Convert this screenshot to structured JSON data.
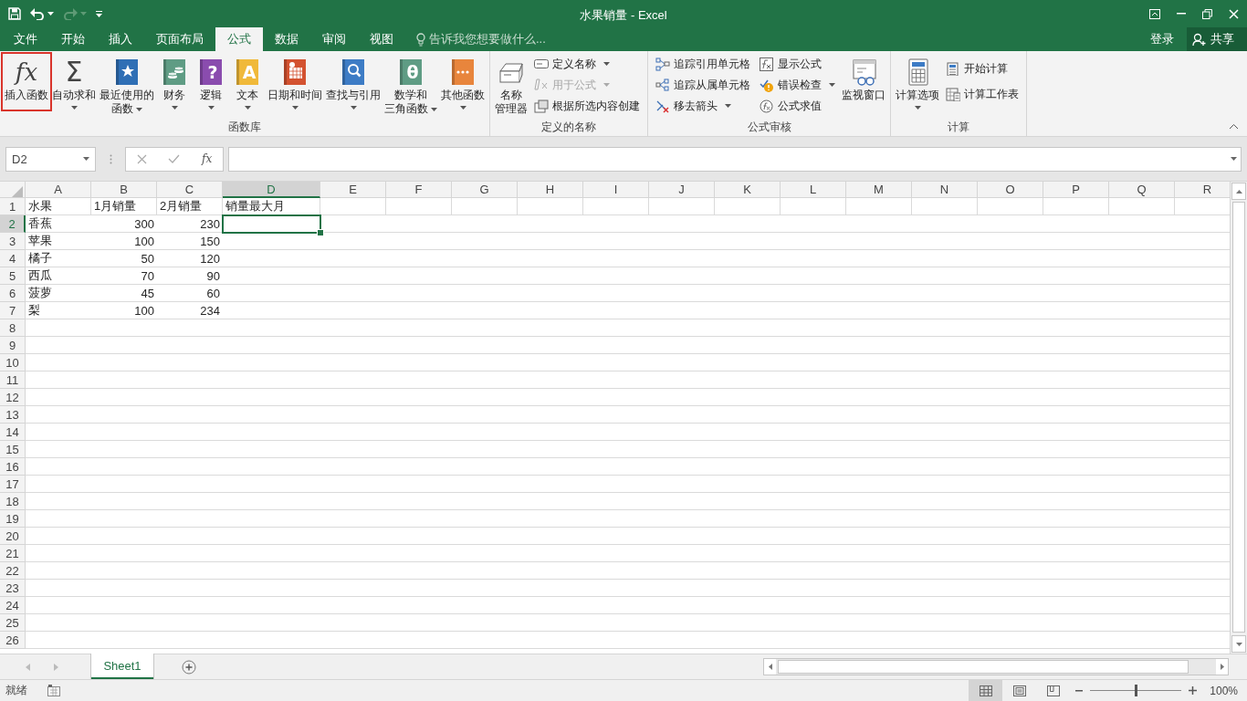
{
  "window": {
    "title": "水果销量 - Excel"
  },
  "tabs": [
    {
      "label": "文件",
      "selected": false
    },
    {
      "label": "开始",
      "selected": false
    },
    {
      "label": "插入",
      "selected": false
    },
    {
      "label": "页面布局",
      "selected": false
    },
    {
      "label": "公式",
      "selected": true
    },
    {
      "label": "数据",
      "selected": false
    },
    {
      "label": "审阅",
      "selected": false
    },
    {
      "label": "视图",
      "selected": false
    }
  ],
  "tell_me": {
    "placeholder": "告诉我您想要做什么..."
  },
  "account": {
    "sign_in": "登录",
    "share": "共享"
  },
  "ribbon": {
    "groups": [
      {
        "label": "函数库",
        "commands": [
          {
            "kind": "large",
            "lines": [
              "插入函数"
            ],
            "glyph": "fx",
            "dropdown": false,
            "disabled": false,
            "outlined": true
          },
          {
            "kind": "large",
            "lines": [
              "自动求和"
            ],
            "glyph": "Σ",
            "dropdown": true,
            "disabled": false,
            "outlined": false
          },
          {
            "kind": "large",
            "lines": [
              "最近使用的",
              "函数"
            ],
            "dropdown": true,
            "disabled": false,
            "outlined": false
          },
          {
            "kind": "large",
            "lines": [
              "财务"
            ],
            "dropdown": true,
            "disabled": false,
            "outlined": false
          },
          {
            "kind": "large",
            "lines": [
              "逻辑"
            ],
            "glyph": "?",
            "dropdown": true,
            "disabled": false,
            "outlined": false
          },
          {
            "kind": "large",
            "lines": [
              "文本"
            ],
            "glyph": "A",
            "dropdown": true,
            "disabled": false,
            "outlined": false
          },
          {
            "kind": "large",
            "lines": [
              "日期和时间"
            ],
            "dropdown": true,
            "disabled": false,
            "outlined": false
          },
          {
            "kind": "large",
            "lines": [
              "查找与引用"
            ],
            "dropdown": true,
            "disabled": false,
            "outlined": false
          },
          {
            "kind": "large",
            "lines": [
              "数学和",
              "三角函数"
            ],
            "glyph": "θ",
            "dropdown": true,
            "disabled": false,
            "outlined": false
          },
          {
            "kind": "large",
            "lines": [
              "其他函数"
            ],
            "dropdown": true,
            "disabled": false,
            "outlined": false
          }
        ]
      },
      {
        "label": "定义的名称",
        "commands": [
          {
            "kind": "large",
            "lines": [
              "名称",
              "管理器"
            ],
            "dropdown": false,
            "disabled": false,
            "outlined": false
          },
          {
            "kind": "small",
            "label": "定义名称",
            "dropdown": true,
            "disabled": false,
            "outlined": false
          },
          {
            "kind": "small",
            "label": "用于公式",
            "dropdown": true,
            "disabled": true,
            "outlined": false
          },
          {
            "kind": "small",
            "label": "根据所选内容创建",
            "dropdown": false,
            "disabled": false,
            "outlined": false
          }
        ]
      },
      {
        "label": "公式审核",
        "commands": [
          {
            "kind": "small",
            "label": "追踪引用单元格",
            "dropdown": false,
            "disabled": false,
            "outlined": false
          },
          {
            "kind": "small",
            "label": "追踪从属单元格",
            "dropdown": false,
            "disabled": false,
            "outlined": false
          },
          {
            "kind": "small",
            "label": "移去箭头",
            "dropdown": true,
            "disabled": false,
            "outlined": false
          },
          {
            "kind": "small",
            "label": "显示公式",
            "dropdown": false,
            "disabled": false,
            "outlined": false
          },
          {
            "kind": "small",
            "label": "错误检查",
            "dropdown": true,
            "disabled": false,
            "outlined": false
          },
          {
            "kind": "small",
            "label": "公式求值",
            "dropdown": false,
            "disabled": false,
            "outlined": false
          },
          {
            "kind": "large",
            "lines": [
              "监视窗口"
            ],
            "dropdown": false,
            "disabled": false,
            "outlined": false
          }
        ]
      },
      {
        "label": "计算",
        "commands": [
          {
            "kind": "large",
            "lines": [
              "计算选项"
            ],
            "dropdown": true,
            "disabled": false,
            "outlined": false
          },
          {
            "kind": "small",
            "label": "开始计算",
            "dropdown": false,
            "disabled": false,
            "outlined": false
          },
          {
            "kind": "small",
            "label": "计算工作表",
            "dropdown": false,
            "disabled": false,
            "outlined": false
          }
        ]
      }
    ]
  },
  "formula_bar": {
    "name_box": "D2",
    "function_glyph": "fx"
  },
  "sheet": {
    "columns": [
      {
        "label": "A",
        "selected": false
      },
      {
        "label": "B",
        "selected": false
      },
      {
        "label": "C",
        "selected": false
      },
      {
        "label": "D",
        "selected": true
      },
      {
        "label": "E",
        "selected": false
      },
      {
        "label": "F",
        "selected": false
      },
      {
        "label": "G",
        "selected": false
      },
      {
        "label": "H",
        "selected": false
      },
      {
        "label": "I",
        "selected": false
      },
      {
        "label": "J",
        "selected": false
      },
      {
        "label": "K",
        "selected": false
      },
      {
        "label": "L",
        "selected": false
      },
      {
        "label": "M",
        "selected": false
      },
      {
        "label": "N",
        "selected": false
      },
      {
        "label": "O",
        "selected": false
      },
      {
        "label": "P",
        "selected": false
      },
      {
        "label": "Q",
        "selected": false
      },
      {
        "label": "R",
        "selected": false
      }
    ],
    "rows": [
      {
        "label": "1",
        "selected": false,
        "cells": [
          {
            "text": "水果",
            "kind": "text"
          },
          {
            "text": "1月销量",
            "kind": "text"
          },
          {
            "text": "2月销量",
            "kind": "text"
          },
          {
            "text": "销量最大月",
            "kind": "text"
          }
        ]
      },
      {
        "label": "2",
        "selected": true,
        "cells": [
          {
            "text": "香蕉",
            "kind": "text"
          },
          {
            "text": "300",
            "kind": "number"
          },
          {
            "text": "230",
            "kind": "number"
          }
        ]
      },
      {
        "label": "3",
        "selected": false,
        "cells": [
          {
            "text": "苹果",
            "kind": "text"
          },
          {
            "text": "100",
            "kind": "number"
          },
          {
            "text": "150",
            "kind": "number"
          }
        ]
      },
      {
        "label": "4",
        "selected": false,
        "cells": [
          {
            "text": "橘子",
            "kind": "text"
          },
          {
            "text": "50",
            "kind": "number"
          },
          {
            "text": "120",
            "kind": "number"
          }
        ]
      },
      {
        "label": "5",
        "selected": false,
        "cells": [
          {
            "text": "西瓜",
            "kind": "text"
          },
          {
            "text": "70",
            "kind": "number"
          },
          {
            "text": "90",
            "kind": "number"
          }
        ]
      },
      {
        "label": "6",
        "selected": false,
        "cells": [
          {
            "text": "菠萝",
            "kind": "text"
          },
          {
            "text": "45",
            "kind": "number"
          },
          {
            "text": "60",
            "kind": "number"
          }
        ]
      },
      {
        "label": "7",
        "selected": false,
        "cells": [
          {
            "text": "梨",
            "kind": "text"
          },
          {
            "text": "100",
            "kind": "number"
          },
          {
            "text": "234",
            "kind": "number"
          }
        ]
      },
      {
        "label": "8",
        "selected": false
      },
      {
        "label": "9",
        "selected": false
      },
      {
        "label": "10",
        "selected": false
      },
      {
        "label": "11",
        "selected": false
      },
      {
        "label": "12",
        "selected": false
      },
      {
        "label": "13",
        "selected": false
      },
      {
        "label": "14",
        "selected": false
      },
      {
        "label": "15",
        "selected": false
      },
      {
        "label": "16",
        "selected": false
      },
      {
        "label": "17",
        "selected": false
      },
      {
        "label": "18",
        "selected": false
      },
      {
        "label": "19",
        "selected": false
      },
      {
        "label": "20",
        "selected": false
      },
      {
        "label": "21",
        "selected": false
      },
      {
        "label": "22",
        "selected": false
      },
      {
        "label": "23",
        "selected": false
      },
      {
        "label": "24",
        "selected": false
      },
      {
        "label": "25",
        "selected": false
      },
      {
        "label": "26",
        "selected": false
      }
    ]
  },
  "sheet_tabs": [
    {
      "label": "Sheet1",
      "selected": true
    }
  ],
  "status_bar": {
    "status": "就绪",
    "views": [
      {
        "kind": "normal",
        "selected": true
      },
      {
        "kind": "page-layout",
        "selected": false
      },
      {
        "kind": "page-break",
        "selected": false
      }
    ],
    "zoom": {
      "level": 0.5,
      "reading": "100%"
    }
  }
}
